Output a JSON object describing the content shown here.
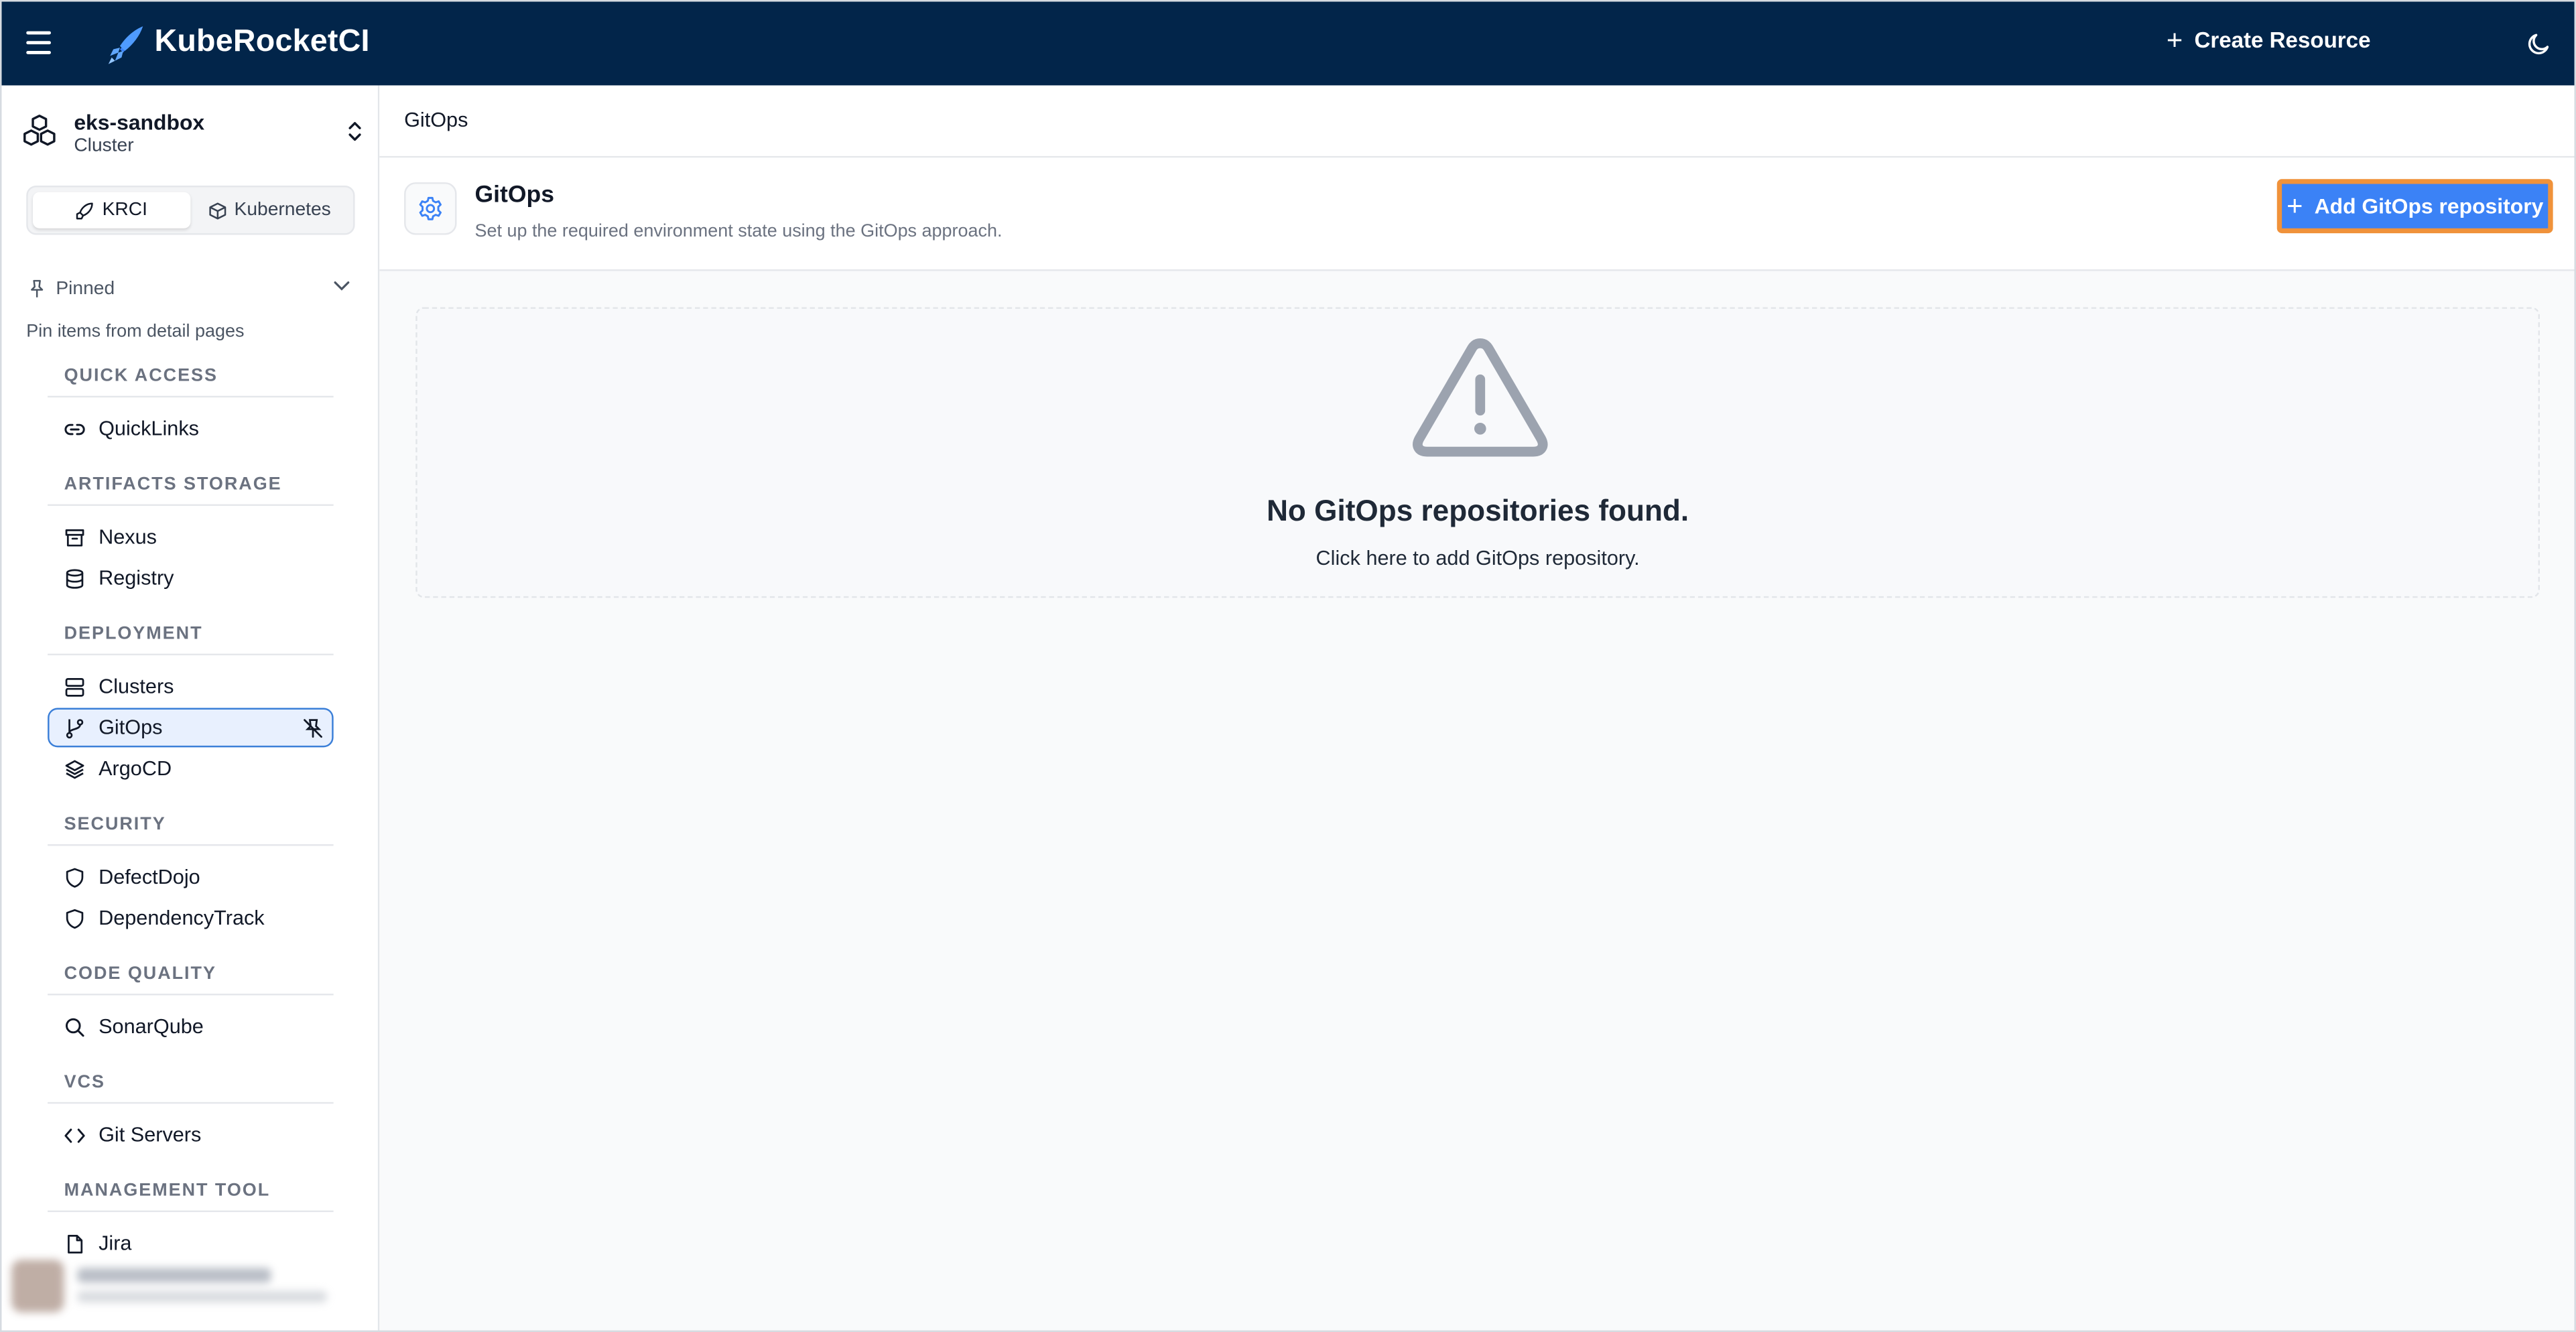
{
  "app": {
    "brand": "KubeRocketCI",
    "create_resource_label": "Create Resource"
  },
  "cluster": {
    "name": "eks-sandbox",
    "type": "Cluster"
  },
  "mode_toggle": {
    "krci_label": "KRCI",
    "kubernetes_label": "Kubernetes",
    "selected": "KRCI"
  },
  "pinned": {
    "label": "Pinned",
    "hint": "Pin items from detail pages"
  },
  "sidebar": {
    "sections": [
      {
        "title": "QUICK ACCESS",
        "items": [
          {
            "label": "QuickLinks",
            "icon": "link-icon"
          }
        ]
      },
      {
        "title": "ARTIFACTS STORAGE",
        "items": [
          {
            "label": "Nexus",
            "icon": "archive-icon"
          },
          {
            "label": "Registry",
            "icon": "database-icon"
          }
        ]
      },
      {
        "title": "DEPLOYMENT",
        "items": [
          {
            "label": "Clusters",
            "icon": "server-icon"
          },
          {
            "label": "GitOps",
            "icon": "git-branch-icon",
            "active": true
          },
          {
            "label": "ArgoCD",
            "icon": "layers-icon"
          }
        ]
      },
      {
        "title": "SECURITY",
        "items": [
          {
            "label": "DefectDojo",
            "icon": "shield-icon"
          },
          {
            "label": "DependencyTrack",
            "icon": "shield-icon"
          }
        ]
      },
      {
        "title": "CODE QUALITY",
        "items": [
          {
            "label": "SonarQube",
            "icon": "search-icon"
          }
        ]
      },
      {
        "title": "VCS",
        "items": [
          {
            "label": "Git Servers",
            "icon": "code-icon"
          }
        ]
      },
      {
        "title": "MANAGEMENT TOOL",
        "items": [
          {
            "label": "Jira",
            "icon": "file-icon"
          }
        ]
      }
    ]
  },
  "breadcrumb": {
    "current": "GitOps"
  },
  "page": {
    "title": "GitOps",
    "subtitle": "Set up the required environment state using the GitOps approach.",
    "add_button_label": "Add GitOps repository"
  },
  "empty_state": {
    "title": "No GitOps repositories found.",
    "subtitle": "Click here to add GitOps repository."
  },
  "colors": {
    "topbar": "#02254a",
    "primary": "#3b82f6",
    "highlight": "#f0923a",
    "active_nav_bg": "#e8f0fe"
  }
}
